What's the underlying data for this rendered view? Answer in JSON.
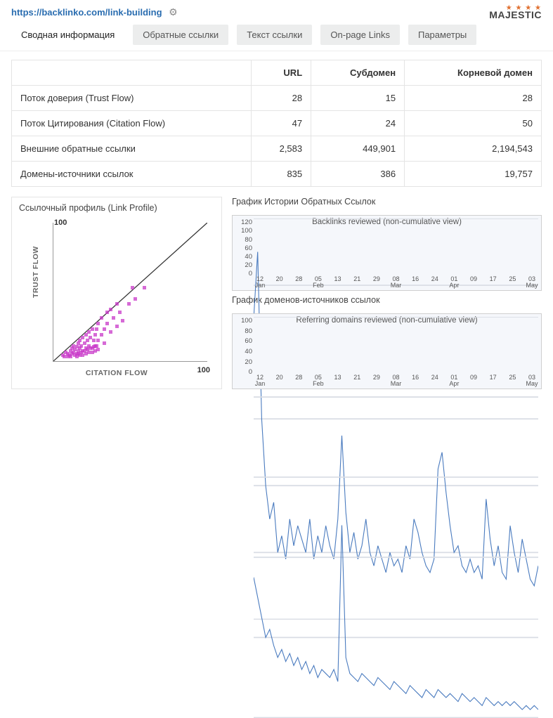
{
  "header": {
    "url": "https://backlinko.com/link-building",
    "logo_text": "MAJESTIC"
  },
  "tabs": [
    {
      "label": "Сводная информация",
      "active": true
    },
    {
      "label": "Обратные ссылки",
      "active": false
    },
    {
      "label": "Текст ссылки",
      "active": false
    },
    {
      "label": "On-page Links",
      "active": false
    },
    {
      "label": "Параметры",
      "active": false
    }
  ],
  "table": {
    "columns": [
      "",
      "URL",
      "Субдомен",
      "Корневой домен"
    ],
    "rows": [
      {
        "name": "Поток доверия (Trust Flow)",
        "url": "28",
        "sub": "15",
        "root": "28"
      },
      {
        "name": "Поток Цитирования (Citation Flow)",
        "url": "47",
        "sub": "24",
        "root": "50"
      },
      {
        "name": "Внешние обратные ссылки",
        "url": "2,583",
        "sub": "449,901",
        "root": "2,194,543"
      },
      {
        "name": "Домены-источники ссылок",
        "url": "835",
        "sub": "386",
        "root": "19,757"
      }
    ]
  },
  "link_profile": {
    "title": "Ссылочный профиль (Link Profile)",
    "xlabel": "CITATION FLOW",
    "ylabel": "TRUST FLOW",
    "xmax": "100",
    "ymax": "100"
  },
  "backlinks_history": {
    "section_title": "График Истории Обратных Ссылок",
    "chart_title": "Backlinks reviewed (non-cumulative view)"
  },
  "refdomains_history": {
    "section_title": "График доменов-источников ссылок",
    "chart_title": "Referring domains reviewed (non-cumulative view)"
  },
  "chart_data": [
    {
      "type": "scatter",
      "title": "Ссылочный профиль (Link Profile)",
      "xlabel": "CITATION FLOW",
      "ylabel": "TRUST FLOW",
      "xlim": [
        0,
        100
      ],
      "ylim": [
        0,
        100
      ],
      "points": [
        [
          5,
          3
        ],
        [
          6,
          2
        ],
        [
          7,
          5
        ],
        [
          8,
          4
        ],
        [
          10,
          6
        ],
        [
          11,
          8
        ],
        [
          12,
          5
        ],
        [
          12,
          10
        ],
        [
          13,
          7
        ],
        [
          14,
          9
        ],
        [
          14,
          4
        ],
        [
          15,
          12
        ],
        [
          15,
          6
        ],
        [
          16,
          8
        ],
        [
          16,
          14
        ],
        [
          17,
          10
        ],
        [
          18,
          6
        ],
        [
          18,
          16
        ],
        [
          19,
          12
        ],
        [
          20,
          8
        ],
        [
          20,
          18
        ],
        [
          21,
          14
        ],
        [
          22,
          10
        ],
        [
          22,
          20
        ],
        [
          23,
          16
        ],
        [
          24,
          8
        ],
        [
          24,
          22
        ],
        [
          25,
          14
        ],
        [
          26,
          18
        ],
        [
          26,
          10
        ],
        [
          27,
          22
        ],
        [
          28,
          14
        ],
        [
          28,
          26
        ],
        [
          30,
          18
        ],
        [
          30,
          30
        ],
        [
          32,
          22
        ],
        [
          32,
          12
        ],
        [
          34,
          26
        ],
        [
          34,
          34
        ],
        [
          36,
          20
        ],
        [
          36,
          36
        ],
        [
          38,
          30
        ],
        [
          40,
          40
        ],
        [
          40,
          24
        ],
        [
          42,
          34
        ],
        [
          44,
          28
        ],
        [
          48,
          40
        ],
        [
          50,
          52
        ],
        [
          58,
          52
        ],
        [
          52,
          44
        ],
        [
          8,
          2
        ],
        [
          9,
          3
        ],
        [
          10,
          2
        ],
        [
          11,
          4
        ],
        [
          13,
          3
        ],
        [
          14,
          2
        ],
        [
          15,
          4
        ],
        [
          16,
          3
        ],
        [
          17,
          5
        ],
        [
          18,
          3
        ],
        [
          19,
          6
        ],
        [
          20,
          4
        ],
        [
          21,
          7
        ],
        [
          22,
          5
        ],
        [
          23,
          8
        ],
        [
          24,
          5
        ],
        [
          25,
          9
        ],
        [
          26,
          6
        ],
        [
          27,
          10
        ],
        [
          28,
          7
        ]
      ]
    },
    {
      "type": "line",
      "title": "Backlinks reviewed (non-cumulative view)",
      "xlabel": "",
      "ylabel": "",
      "ylim": [
        0,
        120
      ],
      "yticks": [
        120,
        100,
        80,
        60,
        40,
        20,
        0
      ],
      "x_ticks": [
        "12 Jan",
        "20",
        "28",
        "05 Feb",
        "13",
        "21",
        "29",
        "08 Mar",
        "16",
        "24",
        "01 Apr",
        "09",
        "17",
        "25",
        "03 May"
      ],
      "values": [
        90,
        110,
        60,
        40,
        30,
        35,
        20,
        25,
        18,
        30,
        22,
        28,
        24,
        20,
        30,
        18,
        25,
        20,
        28,
        22,
        18,
        30,
        55,
        32,
        20,
        26,
        18,
        22,
        30,
        20,
        16,
        22,
        18,
        14,
        20,
        16,
        18,
        14,
        22,
        18,
        30,
        26,
        20,
        16,
        14,
        18,
        45,
        50,
        38,
        28,
        20,
        22,
        16,
        14,
        18,
        14,
        16,
        12,
        36,
        24,
        16,
        22,
        14,
        12,
        28,
        20,
        14,
        24,
        18,
        12,
        10,
        16
      ]
    },
    {
      "type": "line",
      "title": "Referring domains reviewed (non-cumulative view)",
      "xlabel": "",
      "ylabel": "",
      "ylim": [
        0,
        100
      ],
      "yticks": [
        100,
        80,
        60,
        40,
        20,
        0
      ],
      "x_ticks": [
        "12 Jan",
        "20",
        "28",
        "05 Feb",
        "13",
        "21",
        "29",
        "08 Mar",
        "16",
        "24",
        "01 Apr",
        "09",
        "17",
        "25",
        "03 May"
      ],
      "values": [
        35,
        30,
        25,
        20,
        22,
        18,
        15,
        17,
        14,
        16,
        13,
        15,
        12,
        14,
        11,
        13,
        10,
        12,
        11,
        10,
        12,
        9,
        48,
        15,
        11,
        10,
        9,
        11,
        10,
        9,
        8,
        10,
        9,
        8,
        7,
        9,
        8,
        7,
        6,
        8,
        7,
        6,
        5,
        7,
        6,
        5,
        7,
        6,
        5,
        6,
        5,
        4,
        6,
        5,
        4,
        5,
        4,
        3,
        5,
        4,
        3,
        4,
        3,
        4,
        3,
        4,
        3,
        2,
        3,
        2,
        3,
        2
      ]
    }
  ]
}
